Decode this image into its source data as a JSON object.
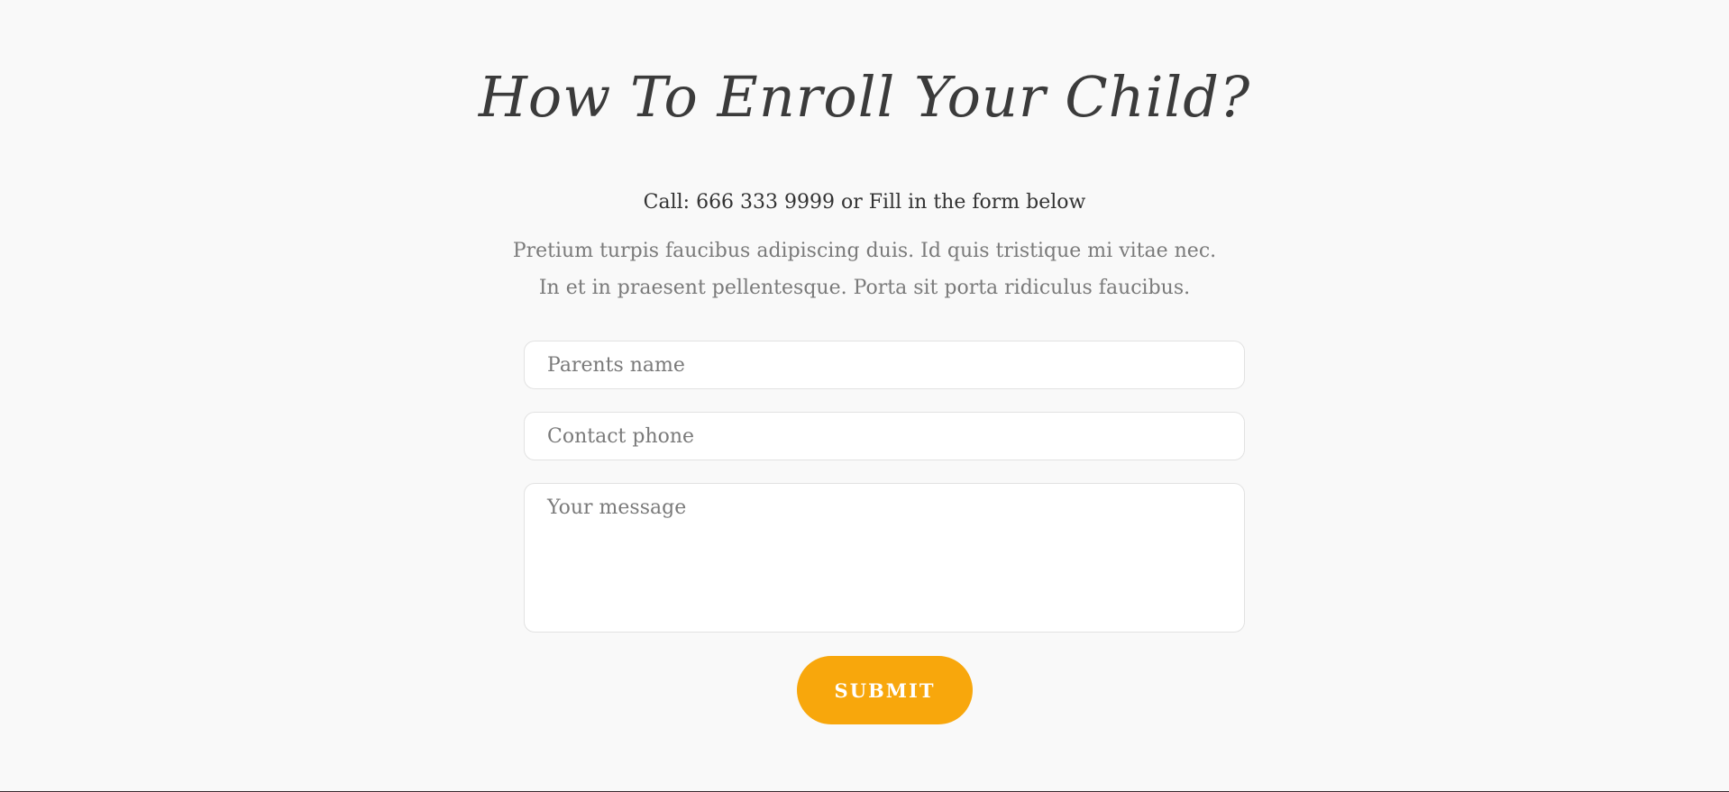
{
  "enroll": {
    "title": "How To Enroll Your Child?",
    "call_text": "Call: 666 333 9999 or Fill in the form below",
    "description_line_1": "Pretium turpis faucibus adipiscing duis. Id quis tristique mi vitae nec.",
    "description_line_2": "In et in praesent pellentesque. Porta sit porta ridiculus faucibus."
  },
  "form": {
    "parents_name": {
      "value": "",
      "placeholder": "Parents name"
    },
    "contact_phone": {
      "value": "",
      "placeholder": "Contact phone"
    },
    "message": {
      "value": "",
      "placeholder": "Your message"
    },
    "submit_label": "SUBMIT"
  },
  "colors": {
    "background": "#f9f9f9",
    "title": "#3b3b3b",
    "body_text": "#7a7a7a",
    "accent": "#f8a70c"
  }
}
